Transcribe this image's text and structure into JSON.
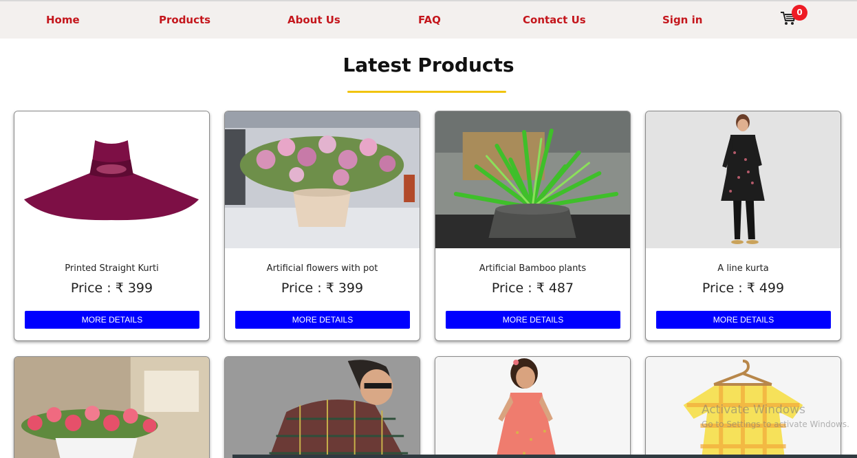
{
  "nav": {
    "home": "Home",
    "products": "Products",
    "about": "About Us",
    "faq": "FAQ",
    "contact": "Contact Us",
    "signin": "Sign in",
    "cart_count": "0",
    "cart_icon": "cart-icon"
  },
  "section": {
    "title": "Latest Products"
  },
  "products": [
    {
      "name": "Printed Straight Kurti",
      "price": "Price : ₹ 399",
      "button": "MORE DETAILS"
    },
    {
      "name": "Artificial flowers with pot",
      "price": "Price : ₹ 399",
      "button": "MORE DETAILS"
    },
    {
      "name": "Artificial Bamboo plants",
      "price": "Price : ₹ 487",
      "button": "MORE DETAILS"
    },
    {
      "name": "A line kurta",
      "price": "Price : ₹ 499",
      "button": "MORE DETAILS"
    }
  ],
  "watermark": {
    "title": "Activate Windows",
    "subtitle": "Go to Settings to activate Windows."
  },
  "colors": {
    "nav_bg": "#f3f0ee",
    "nav_link": "#c4161c",
    "badge": "#ee1b24",
    "accent_underline": "#f1c40f",
    "button": "#0000ff"
  }
}
